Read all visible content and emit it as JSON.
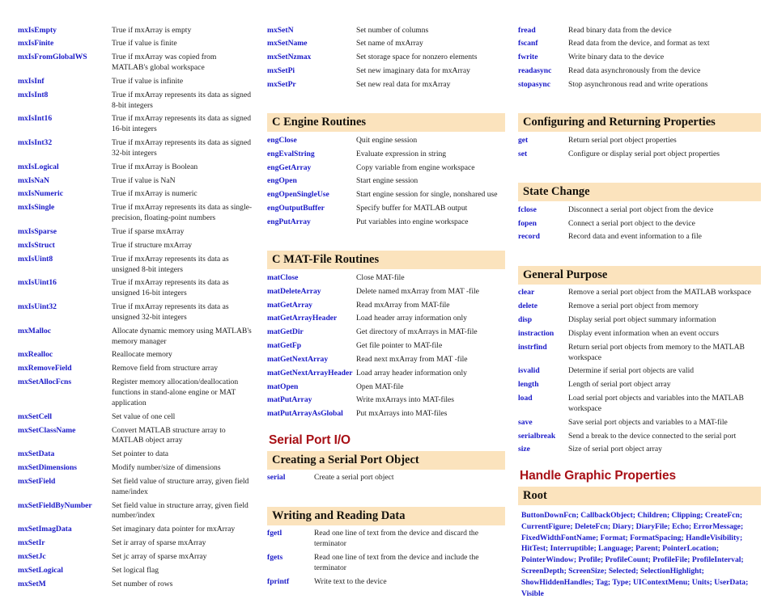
{
  "colors": {
    "function_blue": "#1a1ac8",
    "heading_red": "#a81016",
    "band_peach": "#fbe3bd",
    "body_text": "#1c1c1c"
  },
  "column1": {
    "entries": [
      {
        "name": "mxIsEmpty",
        "desc": "True if mxArray is empty"
      },
      {
        "name": "mxIsFinite",
        "desc": "True if value is finite"
      },
      {
        "name": "mxIsFromGlobalWS",
        "desc": "True if mxArray was copied from MATLAB's global workspace"
      },
      {
        "name": "mxIsInf",
        "desc": "True if value is infinite"
      },
      {
        "name": "mxIsInt8",
        "desc": "True if mxArray represents its data as signed 8-bit integers"
      },
      {
        "name": "mxIsInt16",
        "desc": "True if mxArray represents its data as signed 16-bit integers"
      },
      {
        "name": "mxIsInt32",
        "desc": "True if mxArray represents its data as signed 32-bit integers"
      },
      {
        "name": "mxIsLogical",
        "desc": "True if mxArray is Boolean"
      },
      {
        "name": "mxIsNaN",
        "desc": "True if value is NaN"
      },
      {
        "name": "mxIsNumeric",
        "desc": "True if mxArray is numeric"
      },
      {
        "name": "mxIsSingle",
        "desc": "True if mxArray represents its data as single-precision, floating-point numbers"
      },
      {
        "name": "mxIsSparse",
        "desc": "True if sparse mxArray"
      },
      {
        "name": "mxIsStruct",
        "desc": "True if structure mxArray"
      },
      {
        "name": "mxIsUint8",
        "desc": "True if mxArray represents its data as unsigned 8-bit integers"
      },
      {
        "name": "mxIsUint16",
        "desc": "True if mxArray represents its data as unsigned 16-bit integers"
      },
      {
        "name": "mxIsUint32",
        "desc": "True if mxArray represents its data as unsigned 32-bit integers"
      },
      {
        "name": "mxMalloc",
        "desc": "Allocate dynamic memory using MATLAB's memory manager"
      },
      {
        "name": "mxRealloc",
        "desc": "Reallocate memory"
      },
      {
        "name": "mxRemoveField",
        "desc": "Remove field from structure array"
      },
      {
        "name": "mxSetAllocFcns",
        "desc": "Register memory allocation/deallocation functions in stand-alone engine or MAT application"
      },
      {
        "name": "mxSetCell",
        "desc": "Set value of one cell"
      },
      {
        "name": "mxSetClassName",
        "desc": "Convert MATLAB structure array to MATLAB object array"
      },
      {
        "name": "mxSetData",
        "desc": "Set pointer to data"
      },
      {
        "name": "mxSetDimensions",
        "desc": "Modify number/size of dimensions"
      },
      {
        "name": "mxSetField",
        "desc": "Set field value of structure array, given field name/index"
      },
      {
        "name": "mxSetFieldByNumber",
        "desc": "Set field value in structure array, given field number/index"
      },
      {
        "name": "mxSetImagData",
        "desc": "Set imaginary data pointer for mxArray"
      },
      {
        "name": "mxSetIr",
        "desc": "Set ir array of sparse mxArray"
      },
      {
        "name": "mxSetJc",
        "desc": "Set jc array of sparse mxArray"
      },
      {
        "name": "mxSetLogical",
        "desc": "Set logical flag"
      },
      {
        "name": "mxSetM",
        "desc": "Set number of rows"
      }
    ]
  },
  "column2": {
    "top_entries": [
      {
        "name": "mxSetN",
        "desc": "Set number of columns"
      },
      {
        "name": "mxSetName",
        "desc": "Set name of mxArray"
      },
      {
        "name": "mxSetNzmax",
        "desc": "Set storage space for nonzero elements"
      },
      {
        "name": "mxSetPi",
        "desc": "Set new imaginary data for mxArray"
      },
      {
        "name": "mxSetPr",
        "desc": "Set new real data for mxArray"
      }
    ],
    "engine": {
      "heading": "C Engine Routines",
      "entries": [
        {
          "name": "engClose",
          "desc": "Quit engine session"
        },
        {
          "name": "engEvalString",
          "desc": "Evaluate expression in string"
        },
        {
          "name": "engGetArray",
          "desc": "Copy variable from engine workspace"
        },
        {
          "name": "engOpen",
          "desc": "Start engine session"
        },
        {
          "name": "engOpenSingleUse",
          "desc": "Start engine session for single, nonshared use"
        },
        {
          "name": "engOutputBuffer",
          "desc": "Specify buffer for MATLAB output"
        },
        {
          "name": "engPutArray",
          "desc": "Put variables into engine workspace"
        }
      ]
    },
    "matfile": {
      "heading": "C  MAT-File Routines",
      "entries": [
        {
          "name": "matClose",
          "desc": "Close MAT-file"
        },
        {
          "name": "matDeleteArray",
          "desc": "Delete named mxArray from MAT -file"
        },
        {
          "name": "matGetArray",
          "desc": "Read mxArray from MAT-file"
        },
        {
          "name": "matGetArrayHeader",
          "desc": "Load header array information only"
        },
        {
          "name": "matGetDir",
          "desc": "Get directory of mxArrays in MAT-file"
        },
        {
          "name": "matGetFp",
          "desc": "Get file pointer to MAT-file"
        },
        {
          "name": "matGetNextArray",
          "desc": "Read next mxArray from MAT -file"
        },
        {
          "name": "matGetNextArrayHeader",
          "desc": "Load array header information only"
        },
        {
          "name": "matOpen",
          "desc": "Open MAT-file"
        },
        {
          "name": "matPutArray",
          "desc": "Write mxArrays into MAT-files"
        },
        {
          "name": "matPutArrayAsGlobal",
          "desc": "Put mxArrays into MAT-files"
        }
      ]
    },
    "serial_port_io": {
      "heading": "Serial Port I/O",
      "creating": {
        "heading": "Creating a Serial Port Object",
        "entries": [
          {
            "name": "serial",
            "desc": "Create a serial port object"
          }
        ]
      },
      "writing_reading": {
        "heading": "Writing and Reading Data",
        "entries": [
          {
            "name": "fgetl",
            "desc": "Read one line of text from the device and discard the terminator"
          },
          {
            "name": "fgets",
            "desc": "Read one line of text from the device and include the terminator"
          },
          {
            "name": "fprintf",
            "desc": "Write text to the device"
          }
        ]
      }
    }
  },
  "column3": {
    "top_entries": [
      {
        "name": "fread",
        "desc": "Read binary data from the device"
      },
      {
        "name": "fscanf",
        "desc": "Read data from the device, and format as text"
      },
      {
        "name": "fwrite",
        "desc": "Write binary data to the device"
      },
      {
        "name": "readasync",
        "desc": "Read data asynchronously from the device"
      },
      {
        "name": "stopasync",
        "desc": "Stop asynchronous read and write operations"
      }
    ],
    "configuring": {
      "heading": "Configuring and Returning Properties",
      "entries": [
        {
          "name": "get",
          "desc": "Return serial port object properties"
        },
        {
          "name": "set",
          "desc": "Configure or display serial port object properties"
        }
      ]
    },
    "state_change": {
      "heading": "State Change",
      "entries": [
        {
          "name": "fclose",
          "desc": "Disconnect a serial port object from the device"
        },
        {
          "name": "fopen",
          "desc": "Connect a serial port object to the device"
        },
        {
          "name": "record",
          "desc": "Record data and event information to a file"
        }
      ]
    },
    "general_purpose": {
      "heading": "General Purpose",
      "entries": [
        {
          "name": "clear",
          "desc": "Remove a serial port object from the MATLAB workspace"
        },
        {
          "name": "delete",
          "desc": "Remove a serial port object from memory"
        },
        {
          "name": "disp",
          "desc": "Display serial port object summary information"
        },
        {
          "name": "instraction",
          "desc": "Display event information when an event occurs"
        },
        {
          "name": "instrfind",
          "desc": "Return serial port objects from memory to the MATLAB workspace"
        },
        {
          "name": "isvalid",
          "desc": "Determine if serial port objects are valid"
        },
        {
          "name": "length",
          "desc": "Length of serial port object array"
        },
        {
          "name": "load",
          "desc": "Load serial port objects and variables into the MATLAB workspace"
        },
        {
          "name": "save",
          "desc": "Save serial port objects and variables to a MAT-file"
        },
        {
          "name": "serialbreak",
          "desc": "Send a break to the device connected to the serial port"
        },
        {
          "name": "size",
          "desc": "Size of serial port object array"
        }
      ]
    },
    "handle_graphic": {
      "heading": "Handle Graphic Properties",
      "root": {
        "heading": "Root",
        "properties": "ButtonDownFcn; CallbackObject; Children; Clipping; CreateFcn; CurrentFigure; DeleteFcn; Diary; DiaryFile; Echo; ErrorMessage; FixedWidthFontName; Format; FormatSpacing; HandleVisibility; HitTest; Interruptible; Language; Parent; PointerLocation; PointerWindow; Profile; ProfileCount; ProfileFile; ProfileInterval; ScreenDepth; ScreenSize; Selected; SelectionHighlight; ShowHiddenHandles; Tag; Type; UIContextMenu; Units; UserData; Visible"
      }
    }
  }
}
